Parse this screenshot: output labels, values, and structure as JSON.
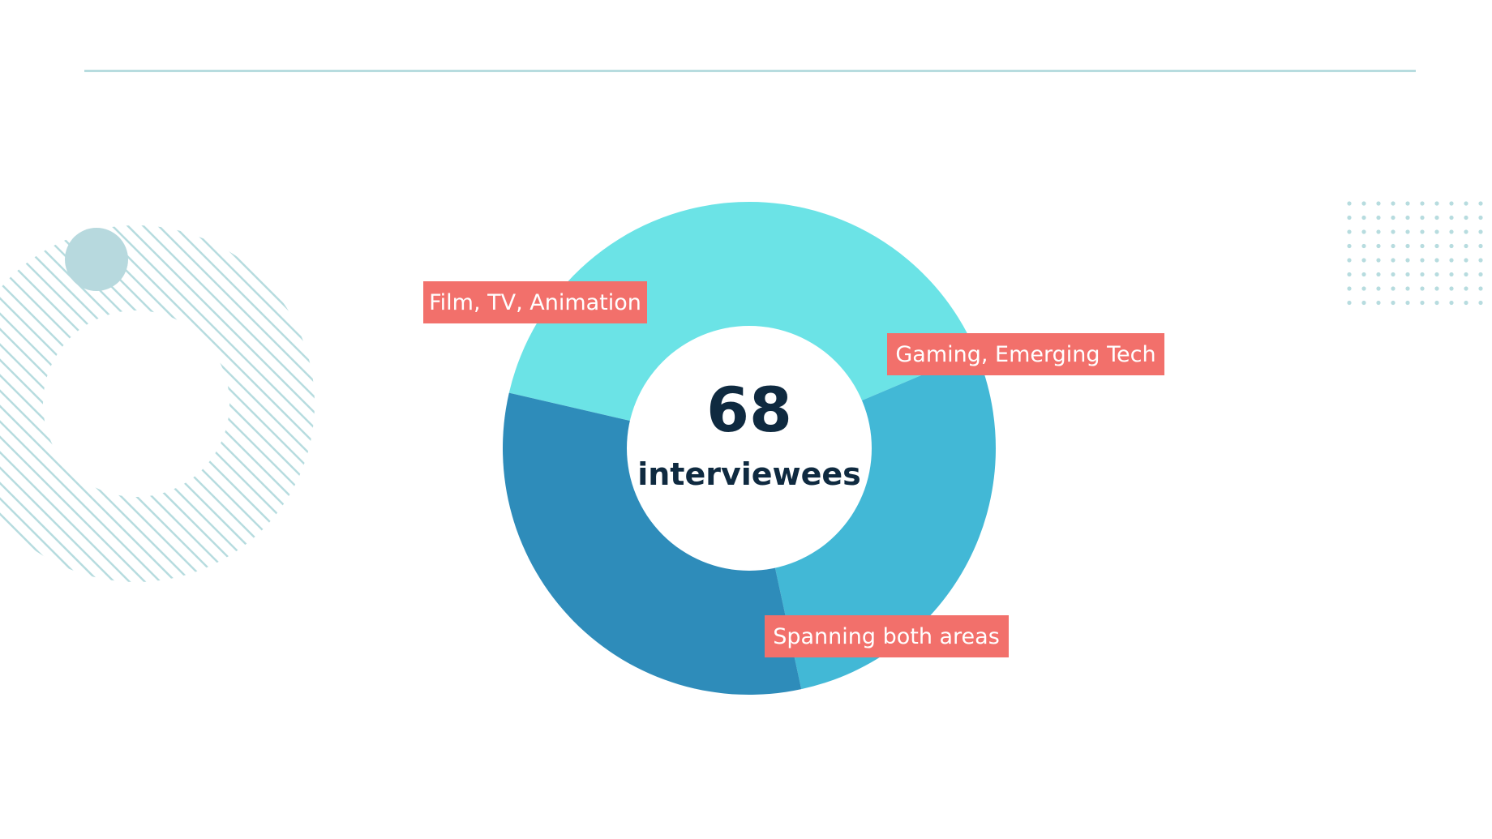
{
  "chart_data": {
    "type": "pie",
    "categories": [
      "Film, TV, Animation",
      "Gaming, Emerging Tech",
      "Spanning both areas"
    ],
    "values": [
      40,
      28,
      32
    ],
    "center_value": "68",
    "center_caption": "interviewees",
    "colors": {
      "Film, TV, Animation": "#6be3e6",
      "Gaming, Emerging Tech": "#42b8d6",
      "Spanning both areas": "#2e8cba"
    },
    "label_color": "#f2706b",
    "text_color": "#0f2a40"
  },
  "decor": {
    "accent_line_color": "#b7dcdf",
    "circle_color": "#b7d9de",
    "stripe_color": "#b7dcdf",
    "dot_color": "#b7dcdf"
  }
}
